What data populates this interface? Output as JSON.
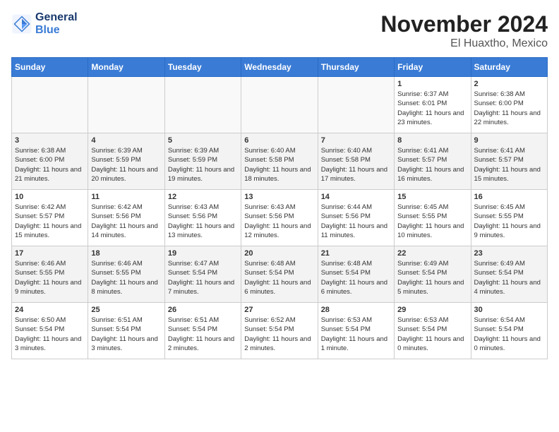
{
  "header": {
    "logo_line1": "General",
    "logo_line2": "Blue",
    "month": "November 2024",
    "location": "El Huaxtho, Mexico"
  },
  "weekdays": [
    "Sunday",
    "Monday",
    "Tuesday",
    "Wednesday",
    "Thursday",
    "Friday",
    "Saturday"
  ],
  "weeks": [
    [
      {
        "day": "",
        "info": ""
      },
      {
        "day": "",
        "info": ""
      },
      {
        "day": "",
        "info": ""
      },
      {
        "day": "",
        "info": ""
      },
      {
        "day": "",
        "info": ""
      },
      {
        "day": "1",
        "info": "Sunrise: 6:37 AM\nSunset: 6:01 PM\nDaylight: 11 hours and 23 minutes."
      },
      {
        "day": "2",
        "info": "Sunrise: 6:38 AM\nSunset: 6:00 PM\nDaylight: 11 hours and 22 minutes."
      }
    ],
    [
      {
        "day": "3",
        "info": "Sunrise: 6:38 AM\nSunset: 6:00 PM\nDaylight: 11 hours and 21 minutes."
      },
      {
        "day": "4",
        "info": "Sunrise: 6:39 AM\nSunset: 5:59 PM\nDaylight: 11 hours and 20 minutes."
      },
      {
        "day": "5",
        "info": "Sunrise: 6:39 AM\nSunset: 5:59 PM\nDaylight: 11 hours and 19 minutes."
      },
      {
        "day": "6",
        "info": "Sunrise: 6:40 AM\nSunset: 5:58 PM\nDaylight: 11 hours and 18 minutes."
      },
      {
        "day": "7",
        "info": "Sunrise: 6:40 AM\nSunset: 5:58 PM\nDaylight: 11 hours and 17 minutes."
      },
      {
        "day": "8",
        "info": "Sunrise: 6:41 AM\nSunset: 5:57 PM\nDaylight: 11 hours and 16 minutes."
      },
      {
        "day": "9",
        "info": "Sunrise: 6:41 AM\nSunset: 5:57 PM\nDaylight: 11 hours and 15 minutes."
      }
    ],
    [
      {
        "day": "10",
        "info": "Sunrise: 6:42 AM\nSunset: 5:57 PM\nDaylight: 11 hours and 15 minutes."
      },
      {
        "day": "11",
        "info": "Sunrise: 6:42 AM\nSunset: 5:56 PM\nDaylight: 11 hours and 14 minutes."
      },
      {
        "day": "12",
        "info": "Sunrise: 6:43 AM\nSunset: 5:56 PM\nDaylight: 11 hours and 13 minutes."
      },
      {
        "day": "13",
        "info": "Sunrise: 6:43 AM\nSunset: 5:56 PM\nDaylight: 11 hours and 12 minutes."
      },
      {
        "day": "14",
        "info": "Sunrise: 6:44 AM\nSunset: 5:56 PM\nDaylight: 11 hours and 11 minutes."
      },
      {
        "day": "15",
        "info": "Sunrise: 6:45 AM\nSunset: 5:55 PM\nDaylight: 11 hours and 10 minutes."
      },
      {
        "day": "16",
        "info": "Sunrise: 6:45 AM\nSunset: 5:55 PM\nDaylight: 11 hours and 9 minutes."
      }
    ],
    [
      {
        "day": "17",
        "info": "Sunrise: 6:46 AM\nSunset: 5:55 PM\nDaylight: 11 hours and 9 minutes."
      },
      {
        "day": "18",
        "info": "Sunrise: 6:46 AM\nSunset: 5:55 PM\nDaylight: 11 hours and 8 minutes."
      },
      {
        "day": "19",
        "info": "Sunrise: 6:47 AM\nSunset: 5:54 PM\nDaylight: 11 hours and 7 minutes."
      },
      {
        "day": "20",
        "info": "Sunrise: 6:48 AM\nSunset: 5:54 PM\nDaylight: 11 hours and 6 minutes."
      },
      {
        "day": "21",
        "info": "Sunrise: 6:48 AM\nSunset: 5:54 PM\nDaylight: 11 hours and 6 minutes."
      },
      {
        "day": "22",
        "info": "Sunrise: 6:49 AM\nSunset: 5:54 PM\nDaylight: 11 hours and 5 minutes."
      },
      {
        "day": "23",
        "info": "Sunrise: 6:49 AM\nSunset: 5:54 PM\nDaylight: 11 hours and 4 minutes."
      }
    ],
    [
      {
        "day": "24",
        "info": "Sunrise: 6:50 AM\nSunset: 5:54 PM\nDaylight: 11 hours and 3 minutes."
      },
      {
        "day": "25",
        "info": "Sunrise: 6:51 AM\nSunset: 5:54 PM\nDaylight: 11 hours and 3 minutes."
      },
      {
        "day": "26",
        "info": "Sunrise: 6:51 AM\nSunset: 5:54 PM\nDaylight: 11 hours and 2 minutes."
      },
      {
        "day": "27",
        "info": "Sunrise: 6:52 AM\nSunset: 5:54 PM\nDaylight: 11 hours and 2 minutes."
      },
      {
        "day": "28",
        "info": "Sunrise: 6:53 AM\nSunset: 5:54 PM\nDaylight: 11 hours and 1 minute."
      },
      {
        "day": "29",
        "info": "Sunrise: 6:53 AM\nSunset: 5:54 PM\nDaylight: 11 hours and 0 minutes."
      },
      {
        "day": "30",
        "info": "Sunrise: 6:54 AM\nSunset: 5:54 PM\nDaylight: 11 hours and 0 minutes."
      }
    ]
  ]
}
